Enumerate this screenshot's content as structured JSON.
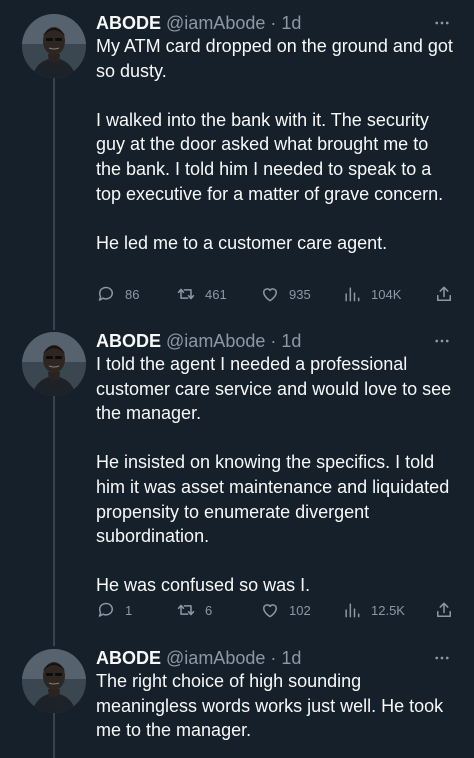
{
  "tweets": [
    {
      "name": "ABODE",
      "handle": "@iamAbode",
      "separator": "·",
      "time": "1d",
      "paragraphs": [
        "My ATM card dropped on the ground and got so dusty.",
        "I walked into the bank with it. The security guy at the door asked what brought me to the bank. I told him I needed to speak to a top executive for a matter of grave concern.",
        "He led me to a customer care agent."
      ],
      "stats": {
        "replies": "86",
        "retweets": "461",
        "likes": "935",
        "views": "104K"
      }
    },
    {
      "name": "ABODE",
      "handle": "@iamAbode",
      "separator": "·",
      "time": "1d",
      "paragraphs": [
        "I told the agent I needed a professional customer care service and would love to see the manager.",
        "He insisted on knowing the specifics. I told him it was asset maintenance and liquidated propensity to enumerate divergent subordination.",
        "He was confused so was I."
      ],
      "stats": {
        "replies": "1",
        "retweets": "6",
        "likes": "102",
        "views": "12.5K"
      }
    },
    {
      "name": "ABODE",
      "handle": "@iamAbode",
      "separator": "·",
      "time": "1d",
      "paragraphs": [
        "The right choice of high sounding meaningless words works just well. He took me to the manager."
      ]
    }
  ],
  "icons": {
    "more": "more-icon",
    "reply": "reply-icon",
    "retweet": "retweet-icon",
    "like": "like-icon",
    "views": "views-icon",
    "share": "share-icon"
  },
  "colors": {
    "background": "#15202b",
    "text": "#f7f9f9",
    "secondary": "#8b98a5",
    "thread_line": "#38444d"
  }
}
